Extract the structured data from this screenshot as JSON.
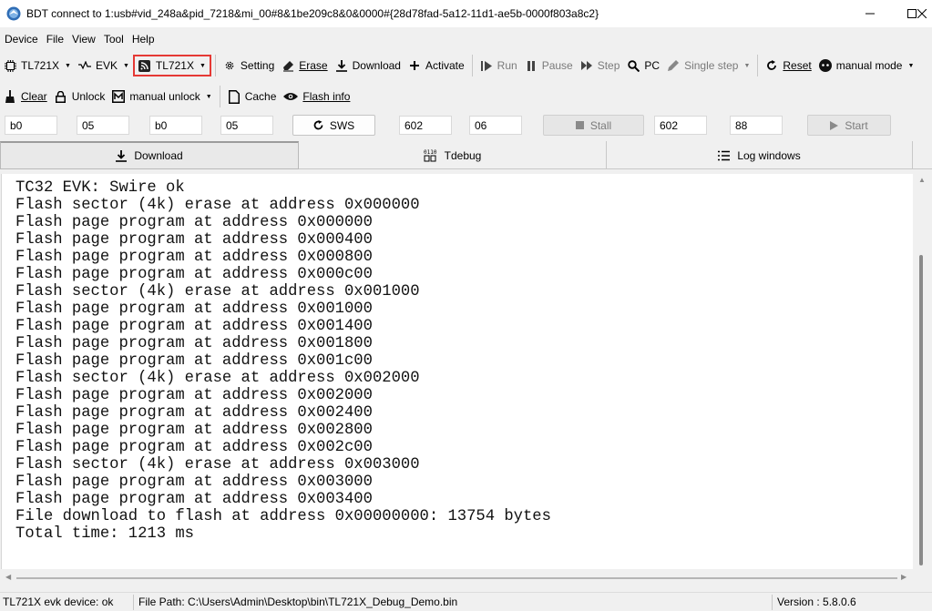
{
  "window": {
    "title": "BDT connect to 1:usb#vid_248a&pid_7218&mi_00#8&1be209c8&0&0000#{28d78fad-5a12-11d1-ae5b-0000f803a8c2}"
  },
  "menu": [
    "Device",
    "File",
    "View",
    "Tool",
    "Help"
  ],
  "toolbar1": {
    "chip": "TL721X",
    "board": "EVK",
    "target": "TL721X",
    "setting": "Setting",
    "erase": "Erase",
    "download": "Download",
    "activate": "Activate",
    "run": "Run",
    "pause": "Pause",
    "step": "Step",
    "pc": "PC",
    "single_step": "Single step",
    "reset": "Reset",
    "mode": "manual mode"
  },
  "toolbar2": {
    "clear": "Clear",
    "unlock": "Unlock",
    "manual_unlock": "manual unlock",
    "cache": "Cache",
    "flash_info": "Flash info"
  },
  "fields": {
    "f1": "b0",
    "f2": "05",
    "f3": "b0",
    "f4": "05",
    "sws": "SWS",
    "f5": "602",
    "f6": "06",
    "stall": "Stall",
    "f7": "602",
    "f8": "88",
    "start": "Start"
  },
  "tabs": [
    "Download",
    "Tdebug",
    "Log windows"
  ],
  "log": [
    "TC32 EVK: Swire ok",
    "Flash sector (4k) erase at address 0x000000",
    "Flash page program at address 0x000000",
    "Flash page program at address 0x000400",
    "Flash page program at address 0x000800",
    "Flash page program at address 0x000c00",
    "Flash sector (4k) erase at address 0x001000",
    "Flash page program at address 0x001000",
    "Flash page program at address 0x001400",
    "Flash page program at address 0x001800",
    "Flash page program at address 0x001c00",
    "Flash sector (4k) erase at address 0x002000",
    "Flash page program at address 0x002000",
    "Flash page program at address 0x002400",
    "Flash page program at address 0x002800",
    "Flash page program at address 0x002c00",
    "Flash sector (4k) erase at address 0x003000",
    "Flash page program at address 0x003000",
    "Flash page program at address 0x003400",
    "File download to flash at address 0x00000000: 13754 bytes",
    "Total time: 1213 ms"
  ],
  "status": {
    "device": "TL721X evk device: ok",
    "filepath": "File Path:  C:\\Users\\Admin\\Desktop\\bin\\TL721X_Debug_Demo.bin",
    "version": "Version : 5.8.0.6"
  },
  "colors": {
    "highlight_border": "#e53935",
    "disabled_text": "#7a7a7a"
  }
}
